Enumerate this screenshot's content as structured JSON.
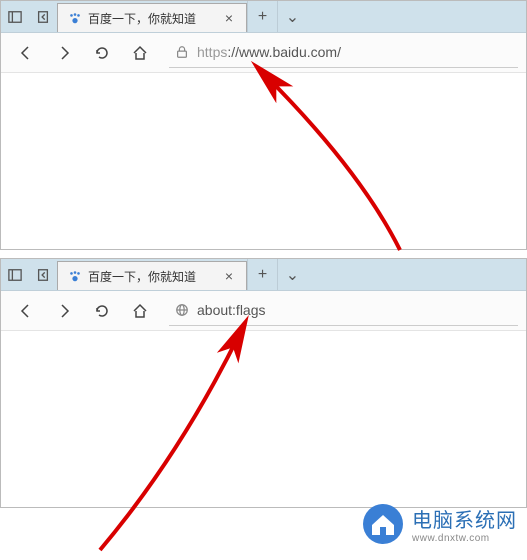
{
  "tabstrip": {
    "tab_title": "百度一下，你就知道",
    "new_tab_glyph": "+",
    "more_tabs_glyph": "⌄",
    "close_glyph": "×"
  },
  "win1": {
    "url_proto": "https",
    "url_rest": "://www.baidu.com/"
  },
  "win2": {
    "url": "about:flags"
  },
  "watermark": {
    "title": "电脑系统网",
    "subtitle": "www.dnxtw.com"
  },
  "colors": {
    "accent": "#2b6fb5",
    "arrow": "#d80000"
  }
}
